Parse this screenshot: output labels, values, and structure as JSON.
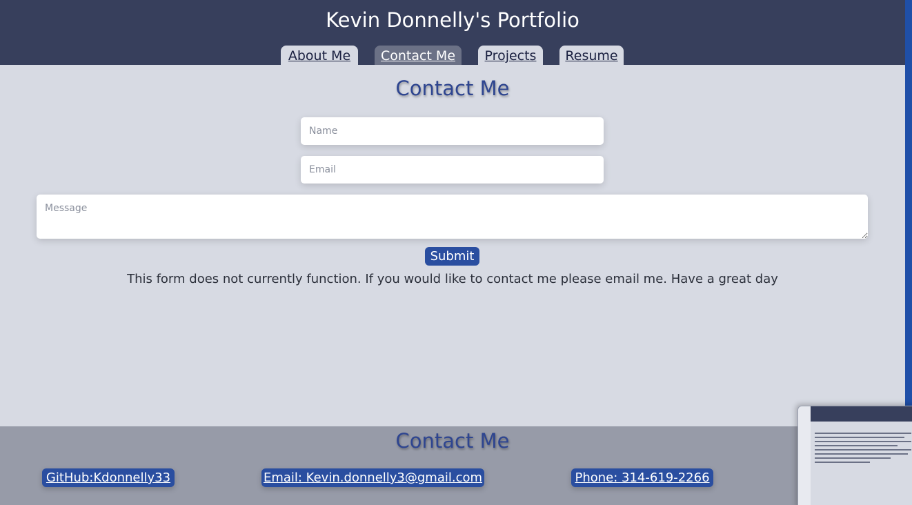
{
  "header": {
    "title": "Kevin Donnelly's Portfolio",
    "nav": [
      {
        "label": "About Me",
        "active": false
      },
      {
        "label": "Contact Me",
        "active": true
      },
      {
        "label": "Projects",
        "active": false
      },
      {
        "label": "Resume",
        "active": false
      }
    ]
  },
  "main": {
    "heading": "Contact Me",
    "form": {
      "name_placeholder": "Name",
      "email_placeholder": "Email",
      "message_placeholder": "Message",
      "submit_label": "Submit"
    },
    "notice": "This form does not currently function. If you would like to contact me please email me. Have a great day"
  },
  "footer": {
    "heading": "Contact Me",
    "links": [
      {
        "label": "GitHub:Kdonnelly33"
      },
      {
        "label": "Email: Kevin.donnelly3@gmail.com"
      },
      {
        "label": "Phone: 314-619-2266"
      }
    ]
  },
  "colors": {
    "header_bg": "#373f5c",
    "page_bg": "#d7dae3",
    "accent": "#2a4ea0",
    "footer_bg": "#979ba8"
  }
}
